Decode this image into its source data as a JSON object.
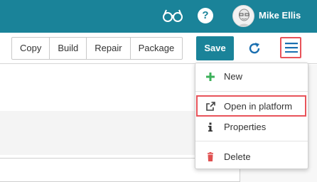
{
  "header": {
    "user_name": "Mike Ellis",
    "icons": [
      "glasses-icon",
      "help-icon",
      "avatar"
    ],
    "help_glyph": "?"
  },
  "toolbar": {
    "group_buttons": [
      "Copy",
      "Build",
      "Repair",
      "Package"
    ],
    "save_label": "Save",
    "icons": [
      "refresh-icon",
      "hamburger-menu-icon"
    ]
  },
  "menu": {
    "items": [
      {
        "label": "New",
        "icon": "plus-icon"
      },
      {
        "label": "Open in platform",
        "icon": "external-link-icon"
      },
      {
        "label": "Properties",
        "icon": "info-icon"
      },
      {
        "label": "Delete",
        "icon": "trash-icon"
      }
    ]
  },
  "colors": {
    "primary": "#1a8399",
    "highlight": "#e8535a",
    "new_icon": "#3cb05a",
    "delete_icon": "#e05050"
  }
}
